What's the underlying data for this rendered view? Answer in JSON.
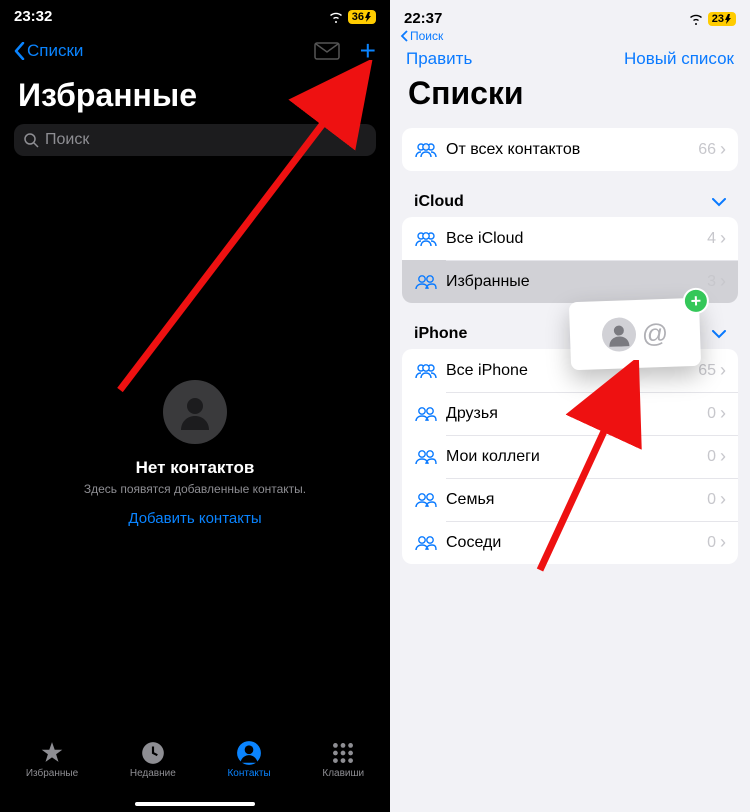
{
  "left": {
    "status_time": "23:32",
    "battery": "36",
    "back_label": "Списки",
    "title": "Избранные",
    "search_placeholder": "Поиск",
    "empty_title": "Нет контактов",
    "empty_sub": "Здесь появятся добавленные контакты.",
    "add_link": "Добавить контакты",
    "tabs": [
      {
        "label": "Избранные"
      },
      {
        "label": "Недавние"
      },
      {
        "label": "Контакты"
      },
      {
        "label": "Клавиши"
      }
    ]
  },
  "right": {
    "status_time": "22:37",
    "battery": "23",
    "search_back": "Поиск",
    "edit": "Править",
    "new_list": "Новый список",
    "title": "Списки",
    "all_contacts": {
      "label": "От всех контактов",
      "count": 66
    },
    "sections": [
      {
        "name": "iCloud",
        "rows": [
          {
            "label": "Все iCloud",
            "count": 4,
            "icon": "group3"
          },
          {
            "label": "Избранные",
            "count": 3,
            "icon": "group2",
            "selected": true
          }
        ]
      },
      {
        "name": "iPhone",
        "rows": [
          {
            "label": "Все iPhone",
            "count": 65,
            "icon": "group3"
          },
          {
            "label": "Друзья",
            "count": 0,
            "icon": "group2"
          },
          {
            "label": "Мои коллеги",
            "count": 0,
            "icon": "group2"
          },
          {
            "label": "Семья",
            "count": 0,
            "icon": "group2"
          },
          {
            "label": "Соседи",
            "count": 0,
            "icon": "group2"
          }
        ]
      }
    ],
    "drag_card_at": "@"
  }
}
